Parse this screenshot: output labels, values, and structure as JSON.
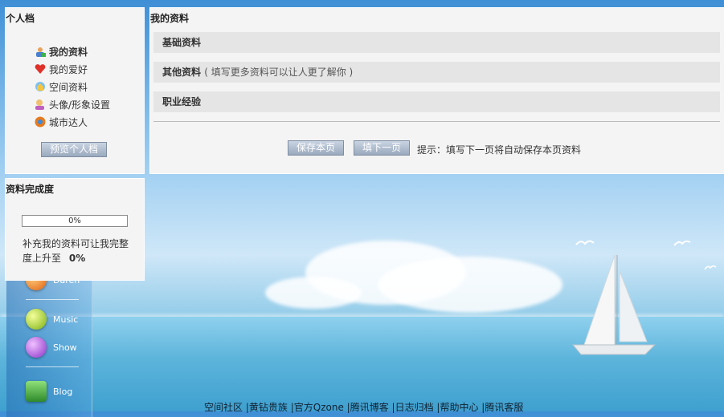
{
  "profile_panel": {
    "title": "个人档",
    "menu": [
      {
        "label": "我的资料",
        "icon": "user-profile-icon",
        "active": true
      },
      {
        "label": "我的爱好",
        "icon": "heart-icon",
        "active": false
      },
      {
        "label": "空间资料",
        "icon": "space-icon",
        "active": false
      },
      {
        "label": "头像/形象设置",
        "icon": "avatar-icon",
        "active": false
      },
      {
        "label": "城市达人",
        "icon": "city-icon",
        "active": false
      }
    ],
    "preview_button": "预览个人档"
  },
  "progress_panel": {
    "title": "资料完成度",
    "percent_text": "0%",
    "percent_value": 0,
    "desc_prefix": "补充我的资料可让我完整度上升至",
    "desc_value": "0%"
  },
  "main_panel": {
    "title": "我的资料",
    "sections": [
      {
        "label": "基础资料",
        "note": ""
      },
      {
        "label": "其他资料",
        "note": "( 填写更多资料可以让人更了解你 )"
      },
      {
        "label": "职业经验",
        "note": ""
      }
    ],
    "save_button": "保存本页",
    "next_button": "填下一页",
    "hint": "提示：填写下一页将自动保存本页资料"
  },
  "dock": {
    "items": [
      {
        "label": "Daren",
        "icon": "daren-icon",
        "color": "#e87a1c"
      },
      {
        "label": "Music",
        "icon": "music-icon",
        "color": "#8cc21f"
      },
      {
        "label": "Show",
        "icon": "show-icon",
        "color": "#a045d8"
      },
      {
        "label": "Blog",
        "icon": "blog-icon",
        "color": "#4caa3a"
      }
    ]
  },
  "footer": {
    "links": [
      "空间社区",
      "|黄钻贵族",
      "|官方Qzone",
      "|腾讯博客",
      "|日志归档",
      "|帮助中心",
      "|腾讯客服"
    ]
  }
}
